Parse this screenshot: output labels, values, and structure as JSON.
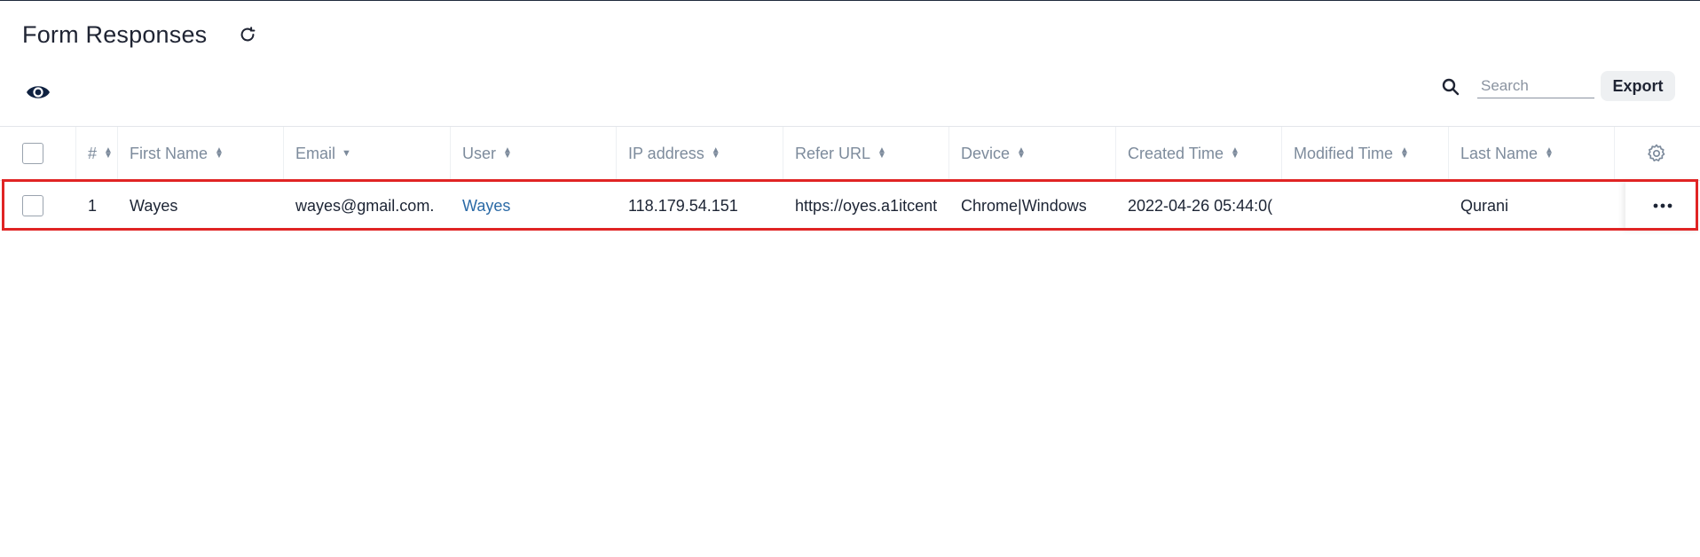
{
  "page": {
    "title": "Form Responses"
  },
  "toolbar": {
    "search_placeholder": "Search",
    "export_label": "Export"
  },
  "icons": {
    "refresh": "refresh-icon",
    "eye": "eye-icon",
    "search": "search-icon",
    "gear": "gear-icon",
    "more": "more-horizontal-icon"
  },
  "colors": {
    "link": "#2b6aa6",
    "highlight": "#e02424",
    "header_text": "#7d8b9c"
  },
  "table": {
    "columns": [
      {
        "label": "#",
        "sort": "both"
      },
      {
        "label": "First Name",
        "sort": "both"
      },
      {
        "label": "Email",
        "sort": "desc"
      },
      {
        "label": "User",
        "sort": "both"
      },
      {
        "label": "IP address",
        "sort": "both"
      },
      {
        "label": "Refer URL",
        "sort": "both"
      },
      {
        "label": "Device",
        "sort": "both"
      },
      {
        "label": "Created Time",
        "sort": "both"
      },
      {
        "label": "Modified Time",
        "sort": "both"
      },
      {
        "label": "Last Name",
        "sort": "both"
      }
    ],
    "rows": [
      {
        "num": "1",
        "first_name": "Wayes",
        "email": "wayes@gmail.com.",
        "user": "Wayes",
        "ip": "118.179.54.151",
        "refer_url": "https://oyes.a1itcent",
        "device": "Chrome|Windows",
        "created": "2022-04-26 05:44:0(",
        "modified": "",
        "last_name": "Qurani"
      }
    ]
  }
}
